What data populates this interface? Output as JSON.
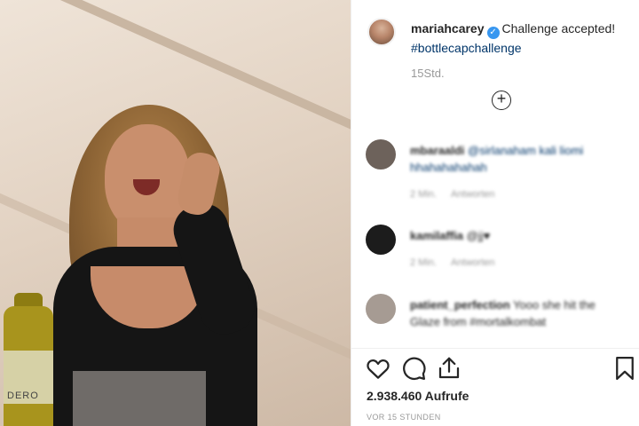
{
  "post": {
    "username": "mariahcarey",
    "caption": "Challenge accepted!",
    "hashtag": "#bottlecapchallenge",
    "time_ago": "15Std.",
    "views": "2.938.460 Aufrufe",
    "posted": "VOR 15 STUNDEN"
  },
  "media": {
    "bottle_label": "DERO"
  },
  "comments": [
    {
      "username": "mbaraaldi",
      "text": "@sirlanaham kali liomi hhahahahahah",
      "time": "2 Min.",
      "reply": "Antworten"
    },
    {
      "username": "kamilaffia",
      "text": "@jj♥",
      "time": "2 Min.",
      "reply": "Antworten"
    },
    {
      "username": "patient_perfection",
      "text": "Yooo she hit the Glaze from #mortalkombat",
      "time": "",
      "reply": ""
    }
  ],
  "icons": {
    "verified": "verified-badge-icon",
    "load_more": "plus-circle-icon",
    "like": "heart-icon",
    "comment": "comment-icon",
    "share": "share-icon",
    "save": "bookmark-icon"
  },
  "colors": {
    "verified": "#3897f0",
    "hashtag": "#003569",
    "text": "#262626",
    "meta": "#999999"
  }
}
